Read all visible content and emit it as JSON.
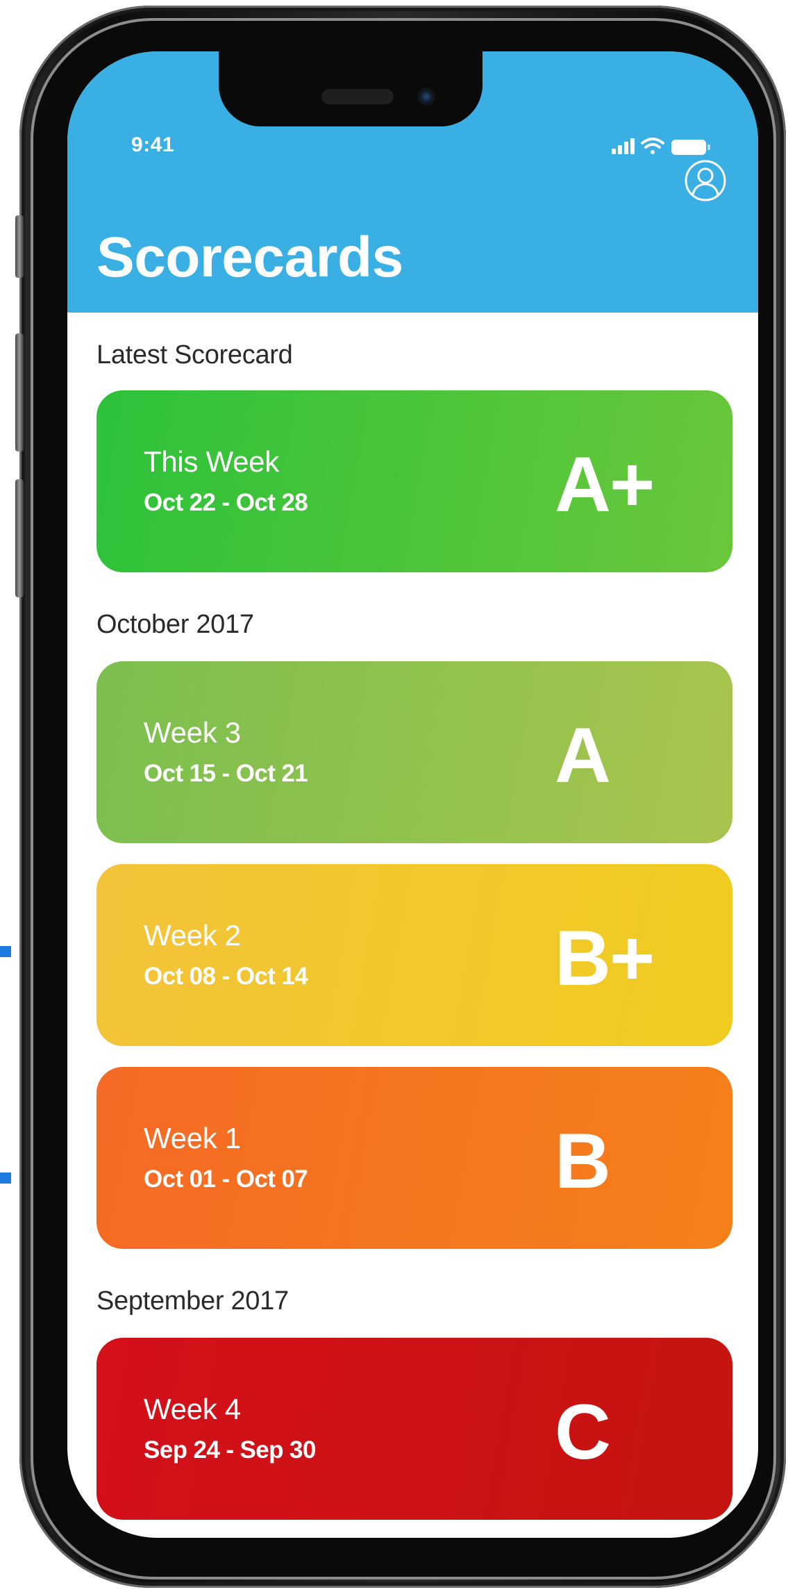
{
  "status_bar": {
    "time": "9:41"
  },
  "header": {
    "title": "Scorecards",
    "profile_icon": "user-profile-icon",
    "background": "#3aafe3"
  },
  "sections": [
    {
      "label": "Latest Scorecard",
      "cards": [
        {
          "week": "This Week",
          "range": "Oct 22 - Oct 28",
          "grade": "A+",
          "color_start": "#2cc23a",
          "color_end": "#6ac73a"
        }
      ]
    },
    {
      "label": "October 2017",
      "cards": [
        {
          "week": "Week 3",
          "range": "Oct 15 - Oct 21",
          "grade": "A",
          "color_start": "#7bbf4f",
          "color_end": "#a8c44d"
        },
        {
          "week": "Week 2",
          "range": "Oct 08 - Oct 14",
          "grade": "B+",
          "color_start": "#f3c33a",
          "color_end": "#f0cc1f"
        },
        {
          "week": "Week 1",
          "range": "Oct 01 - Oct 07",
          "grade": "B",
          "color_start": "#f56a25",
          "color_end": "#f5801a"
        }
      ]
    },
    {
      "label": "September 2017",
      "cards": [
        {
          "week": "Week 4",
          "range": "Sep 24 - Sep 30",
          "grade": "C",
          "color_start": "#d4101a",
          "color_end": "#c51410"
        }
      ]
    }
  ]
}
